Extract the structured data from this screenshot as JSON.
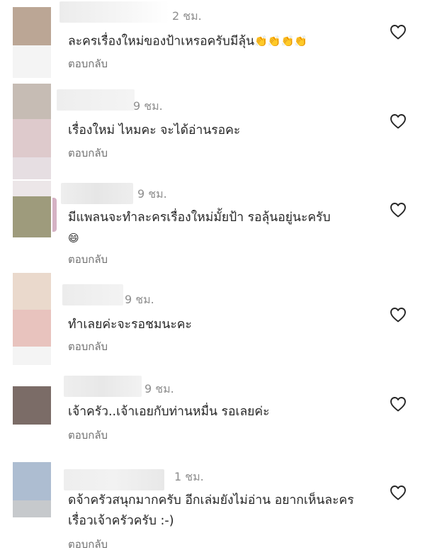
{
  "colors": {
    "text": "#262626",
    "meta": "#8e8e8e",
    "heart_stroke": "#262626"
  },
  "reply_label": "ตอบกลับ",
  "comments": [
    {
      "time": "2 ชม.",
      "text": "ละครเรื่องใหม่ของป้าเหรอครับมีลุ้น",
      "emoji": "👏👏👏👏",
      "reply": "ตอบกลับ"
    },
    {
      "time": "9 ชม.",
      "text": "เรื่องใหม่ ไหมคะ จะได้อ่านรอคะ",
      "reply": "ตอบกลับ"
    },
    {
      "time": "9 ชม.",
      "text": "มีแพลนจะทำละครเรื่องใหม่มั้ยป้า รอลุ้นอยู่นะครับ",
      "emoji": "😄",
      "reply": "ตอบกลับ"
    },
    {
      "time": "9 ชม.",
      "text": "ทำเลยค่ะจะรอชมนะคะ",
      "reply": "ตอบกลับ"
    },
    {
      "time": "9 ชม.",
      "text": "เจ้าครัว..เจ้าเอยกับท่านหมื่น รอเลยค่ะ",
      "reply": "ตอบกลับ"
    },
    {
      "time": "1 ชม.",
      "text": "ดจ้าครัวสนุกมากครับ  อีกเล่มยังไม่อ่าน อยากเห็นละครเรื่อวเจ้าครัวครับ :-)",
      "reply": "ตอบกลับ"
    }
  ]
}
